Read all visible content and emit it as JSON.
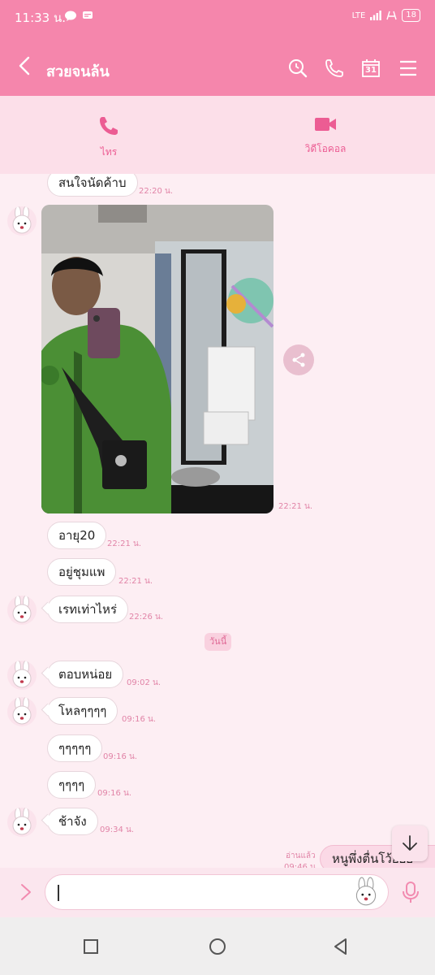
{
  "status_bar": {
    "time": "11:33 น.",
    "network": "LTE",
    "battery": "18"
  },
  "header": {
    "title": "สวยจนล้น",
    "calendar_day": "31"
  },
  "call_bar": {
    "voice_label": "ไทร",
    "video_label": "วิดีโอคอล"
  },
  "messages": [
    {
      "text": "สนใจนัดค้าบ",
      "time": "22:20 น."
    },
    {
      "type": "image",
      "time": "22:21 น."
    },
    {
      "text": "อายุ20",
      "time": "22:21 น."
    },
    {
      "text": "อยู่ชุมแพ",
      "time": "22:21 น."
    },
    {
      "text": "เรทเท่าไหร่",
      "time": "22:26 น."
    },
    {
      "text": "ตอบหน่อย",
      "time": "09:02 น."
    },
    {
      "text": "โหลๆๆๆๆ",
      "time": "09:16 น."
    },
    {
      "text": "ๆๆๆๆๆ",
      "time": "09:16 น."
    },
    {
      "text": "ๆๆๆๆ",
      "time": "09:16 น."
    },
    {
      "text": "ช้าจัง",
      "time": "09:34 น."
    }
  ],
  "date_divider": "วันนี้",
  "my_message": {
    "text": "หนูพึ่งตื่นโว้ยยย",
    "read_label": "อ่านแล้ว",
    "time": "09:46 น."
  },
  "colors": {
    "header_bg": "#f586ac",
    "call_bar_bg": "#fcdfe9",
    "chat_bg": "#fdeef3",
    "accent": "#ec5c93"
  }
}
